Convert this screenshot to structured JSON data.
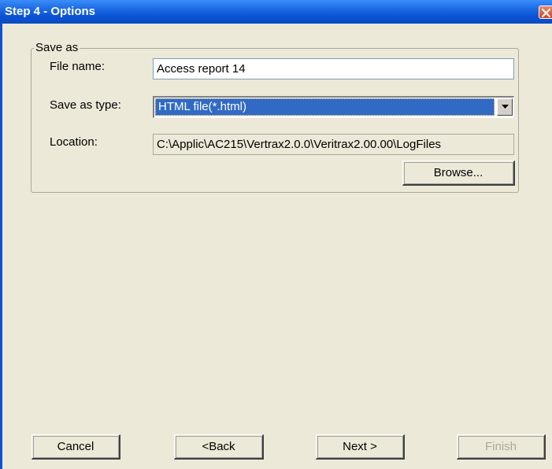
{
  "window": {
    "title": "Step 4 - Options"
  },
  "save_as": {
    "legend": "Save as",
    "file_name_label": "File name:",
    "file_name_value": "Access report 14",
    "type_label": "Save as type:",
    "type_value": "HTML file(*.html)",
    "location_label": "Location:",
    "location_value": "C:\\Applic\\AC215\\Vertrax2.0.0\\Veritrax2.00.00\\LogFiles",
    "browse_label": "Browse..."
  },
  "footer": {
    "cancel_label": "Cancel",
    "back_label": "<Back",
    "next_label": "Next >",
    "finish_label": "Finish"
  },
  "icons": [
    "close-icon",
    "dropdown-arrow-icon"
  ]
}
